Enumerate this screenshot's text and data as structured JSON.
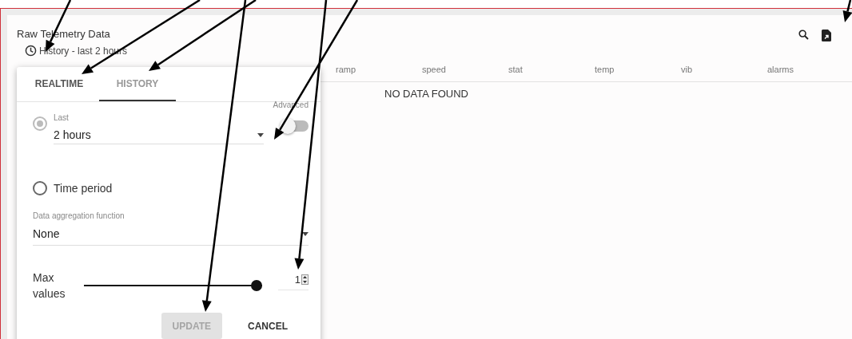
{
  "card": {
    "title": "Raw Telemetry Data",
    "subtitle": "History - last 2 hours"
  },
  "table": {
    "columns": [
      "ramp",
      "speed",
      "stat",
      "temp",
      "vib",
      "alarms"
    ],
    "empty_message": "NO DATA FOUND"
  },
  "popup": {
    "tabs": [
      {
        "label": "REALTIME",
        "selected": false
      },
      {
        "label": "HISTORY",
        "selected": true
      }
    ],
    "last": {
      "label": "Last",
      "selected": true,
      "value": "2 hours",
      "advanced_label": "Advanced",
      "advanced_on": false
    },
    "period": {
      "label": "Time period",
      "selected": false
    },
    "aggregation": {
      "label": "Data aggregation function",
      "value": "None"
    },
    "max_values": {
      "label": "Max values",
      "level": 1,
      "value": "1"
    },
    "buttons": [
      {
        "label": "UPDATE",
        "disabled": true
      },
      {
        "label": "CANCEL",
        "disabled": false
      }
    ]
  }
}
